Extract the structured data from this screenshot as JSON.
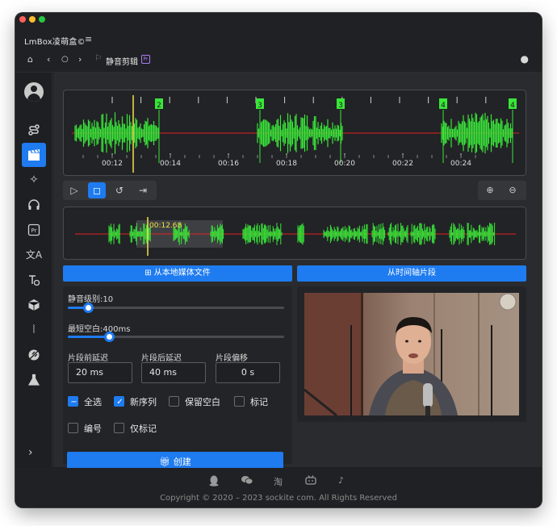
{
  "app": {
    "title": "LmBox凌萌盒©",
    "menu_icon": "hamburger-icon"
  },
  "nav": {
    "page_title": "静音剪辑",
    "badge": "Pr",
    "icons": [
      "home-icon",
      "back-icon",
      "refresh-icon",
      "forward-icon",
      "bookmark-icon",
      "lightbulb-icon"
    ]
  },
  "sidebar": {
    "items": [
      {
        "icon": "avatar-icon"
      },
      {
        "icon": "path-icon"
      },
      {
        "icon": "clapperboard-icon",
        "active": true
      },
      {
        "icon": "sparkle-icon"
      },
      {
        "icon": "headphones-icon"
      },
      {
        "icon": "pr-icon",
        "label": "Pr"
      },
      {
        "icon": "translate-icon"
      },
      {
        "icon": "text-convert-icon"
      },
      {
        "icon": "cube-icon"
      },
      {
        "icon": "wave-tool-icon"
      },
      {
        "icon": "leaf-icon"
      },
      {
        "icon": "flask-icon"
      }
    ],
    "expand_icon": "chevron-right-icon"
  },
  "timeline": {
    "times": [
      "00:12",
      "00:14",
      "00:16",
      "00:18",
      "00:20",
      "00:22",
      "00:24"
    ],
    "markers": [
      "2",
      "3",
      "3",
      "4",
      "4"
    ],
    "overview_time": "00:12.68",
    "waveform_color": "#39e639",
    "silence_color": "#e02020",
    "playhead_color": "#f2e14a"
  },
  "actions": {
    "local_media": "从本地媒体文件",
    "from_timeline": "从时间轴片段"
  },
  "settings": {
    "silence_level_label": "静音级别:10",
    "silence_level": 10,
    "min_gap_label": "最短空白:400ms",
    "min_gap_ms": 400,
    "pre_delay_label": "片段前延迟",
    "pre_delay_value": "20 ms",
    "post_delay_label": "片段后延迟",
    "post_delay_value": "40 ms",
    "offset_label": "片段偏移",
    "offset_value": "0 s",
    "options": {
      "select_all": "全选",
      "new_sequence": "新序列",
      "keep_blank": "保留空白",
      "mark": "标记",
      "number": "编号",
      "mark_only": "仅标记"
    },
    "create": "创建"
  },
  "footer": {
    "icons": [
      "qq-icon",
      "wechat-icon",
      "taobao-icon",
      "bilibili-icon",
      "tiktok-icon"
    ],
    "taobao_glyph": "淘",
    "copyright": "Copyright © 2020 – 2023 sockite com. All Rights Reserved"
  }
}
